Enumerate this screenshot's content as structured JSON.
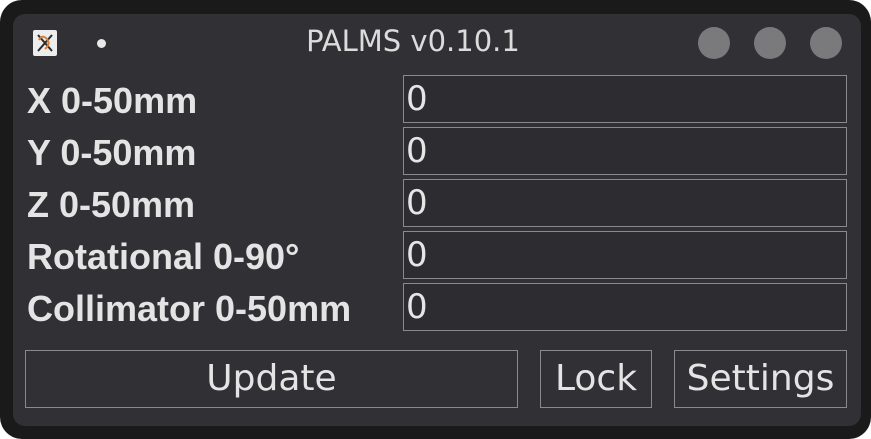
{
  "window": {
    "title": "PALMS v0.10.1",
    "app_icon": "app-logo-icon",
    "controls": [
      "minimize-icon",
      "maximize-icon",
      "close-icon"
    ]
  },
  "form": {
    "rows": [
      {
        "label": "X 0-50mm",
        "value": "0"
      },
      {
        "label": "Y 0-50mm",
        "value": "0"
      },
      {
        "label": "Z 0-50mm",
        "value": "0"
      },
      {
        "label": "Rotational 0-90°",
        "value": "0"
      },
      {
        "label": "Collimator 0-50mm",
        "value": "0"
      }
    ]
  },
  "buttons": {
    "update_label": "Update",
    "lock_label": "Lock",
    "settings_label": "Settings"
  },
  "colors": {
    "window_bg": "#313034",
    "frame_bg": "#1a1a1a",
    "text": "#e4e4e4",
    "border": "#8a898c",
    "window_control": "#7a797c"
  }
}
